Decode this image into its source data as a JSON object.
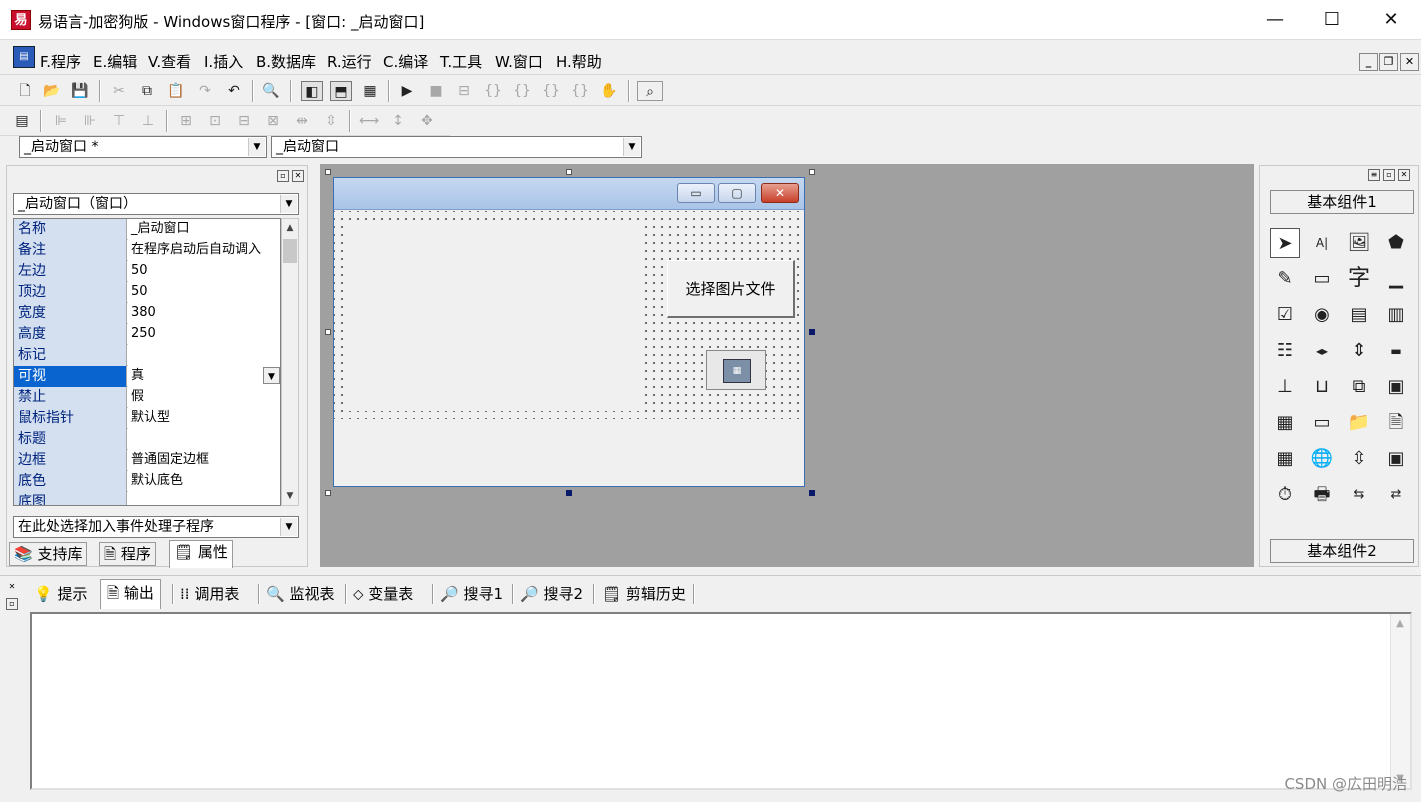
{
  "window": {
    "icon_label": "易",
    "title": "易语言-加密狗版 - Windows窗口程序 - [窗口: _启动窗口]",
    "minimize": "—",
    "maximize": "☐",
    "close": "✕"
  },
  "menu": {
    "items": [
      "F.程序",
      "E.编辑",
      "V.查看",
      "I.插入",
      "B.数据库",
      "R.运行",
      "C.编译",
      "T.工具",
      "W.窗口",
      "H.帮助"
    ],
    "mdi_min": "_",
    "mdi_restore": "❐",
    "mdi_close": "✕"
  },
  "selectors": {
    "window_combo": "_启动窗口 *",
    "object_combo": "_启动窗口"
  },
  "properties": {
    "object_combo": "_启动窗口（窗口）",
    "rows": [
      {
        "name": "名称",
        "value": "_启动窗口"
      },
      {
        "name": "备注",
        "value": "在程序启动后自动调入"
      },
      {
        "name": "左边",
        "value": "50"
      },
      {
        "name": "顶边",
        "value": "50"
      },
      {
        "name": "宽度",
        "value": "380"
      },
      {
        "name": "高度",
        "value": "250"
      },
      {
        "name": "标记",
        "value": ""
      },
      {
        "name": "可视",
        "value": "真"
      },
      {
        "name": "禁止",
        "value": "假"
      },
      {
        "name": "鼠标指针",
        "value": "默认型"
      },
      {
        "name": "标题",
        "value": ""
      },
      {
        "name": "边框",
        "value": "普通固定边框"
      },
      {
        "name": "底色",
        "value": "默认底色"
      },
      {
        "name": "底图",
        "value": ""
      }
    ],
    "event_combo": "在此处选择加入事件处理子程序"
  },
  "left_tabs": [
    "支持库",
    "程序",
    "属性"
  ],
  "form": {
    "button_label": "选择图片文件",
    "dialog_icon": "▦"
  },
  "components": {
    "group1": "基本组件1",
    "group2": "基本组件2",
    "char_icon": "字"
  },
  "bottom_tabs": [
    "提示",
    "输出",
    "调用表",
    "监视表",
    "变量表",
    "搜寻1",
    "搜寻2",
    "剪辑历史"
  ],
  "watermark": "CSDN @広田明浩"
}
